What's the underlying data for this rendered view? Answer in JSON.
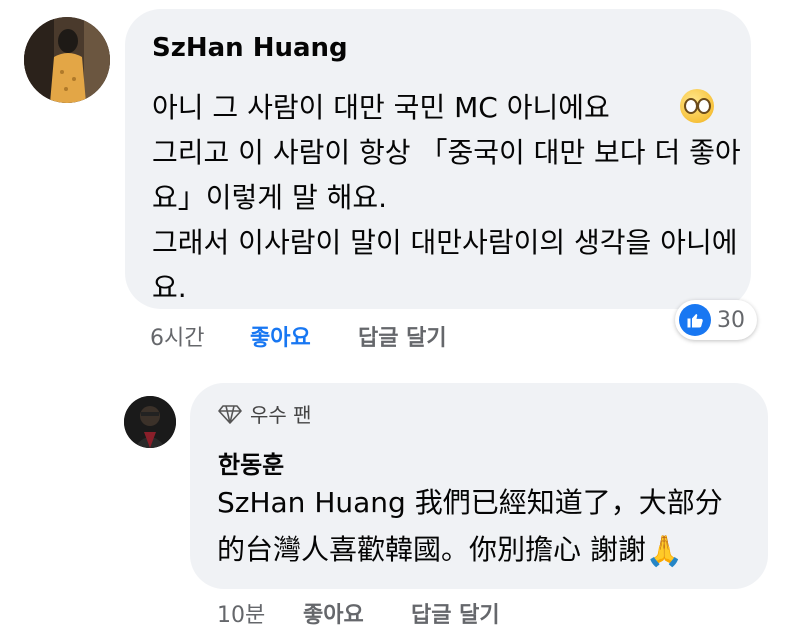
{
  "comment": {
    "author": "SzHan Huang",
    "text": "아니 그 사람이 대만 국민 MC 아니에요 \n그리고 이 사람이 항상 「중국이 대만 보다 더 좋아요」이렇게 말 해요.\n그래서 이사람이 말이 대만사람이의 생각을 아니에요.",
    "emoji": "face-with-rolling-eyes",
    "time": "6시간",
    "like_label": "좋아요",
    "reply_label": "답글 달기",
    "reaction_count": "30"
  },
  "reply": {
    "badge": "우수 팬",
    "author": "한동훈",
    "text": "SzHan Huang 我們已經知道了，大部分的台灣人喜歡韓國。你別擔心 謝謝",
    "emoji": "🙏",
    "time": "10분",
    "like_label": "좋아요",
    "reply_label": "답글 달기"
  },
  "colors": {
    "bubble": "#f0f2f5",
    "like_active": "#1877f2",
    "meta": "#65676b"
  }
}
